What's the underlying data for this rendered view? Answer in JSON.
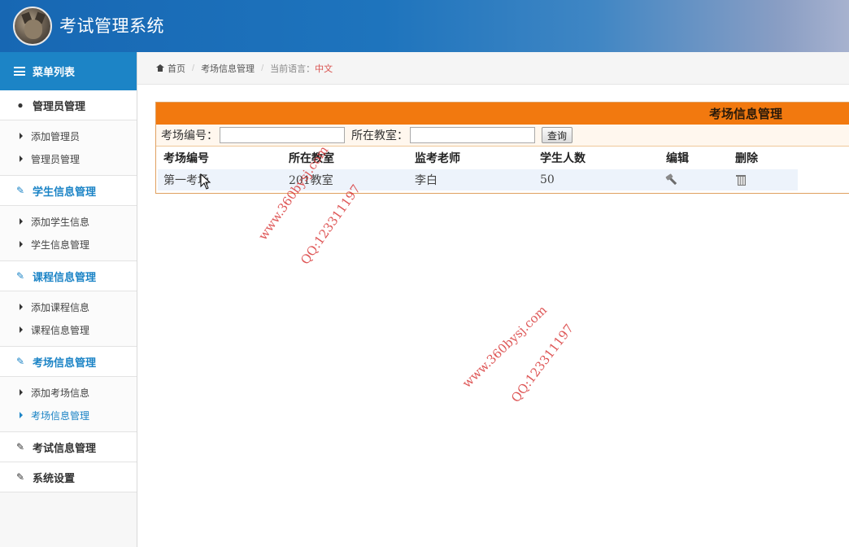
{
  "app": {
    "title": "考试管理系统"
  },
  "sidebar": {
    "menu_title": "菜单列表",
    "groups": [
      {
        "label": "管理员管理",
        "icon": "user-icon",
        "items": [
          "添加管理员",
          "管理员管理"
        ]
      },
      {
        "label": "学生信息管理",
        "icon": "edit-icon",
        "items": [
          "添加学生信息",
          "学生信息管理"
        ]
      },
      {
        "label": "课程信息管理",
        "icon": "edit-icon",
        "items": [
          "添加课程信息",
          "课程信息管理"
        ]
      },
      {
        "label": "考场信息管理",
        "icon": "edit-icon",
        "items": [
          "添加考场信息",
          "考场信息管理"
        ],
        "active_item": "考场信息管理"
      },
      {
        "label": "考试信息管理",
        "icon": "edit-icon",
        "items": []
      },
      {
        "label": "系统设置",
        "icon": "edit-icon",
        "items": []
      }
    ]
  },
  "breadcrumb": {
    "home": "首页",
    "current": "考场信息管理",
    "lang_label": "当前语言：",
    "lang_value": "中文"
  },
  "panel": {
    "title": "考场信息管理",
    "search": {
      "field1_label": "考场编号：",
      "field1_value": "",
      "field2_label": "所在教室：",
      "field2_value": "",
      "button": "查询"
    },
    "columns": [
      "考场编号",
      "所在教室",
      "监考老师",
      "学生人数",
      "编辑",
      "删除"
    ],
    "rows": [
      {
        "id": "第一考场",
        "room": "201教室",
        "teacher": "李白",
        "count": "50"
      }
    ]
  },
  "watermarks": [
    "www.360bysj.com",
    "QQ:123311197"
  ],
  "colors": {
    "accent": "#1c84c6",
    "panel_header": "#f2790f",
    "header_start": "#1767b3"
  }
}
